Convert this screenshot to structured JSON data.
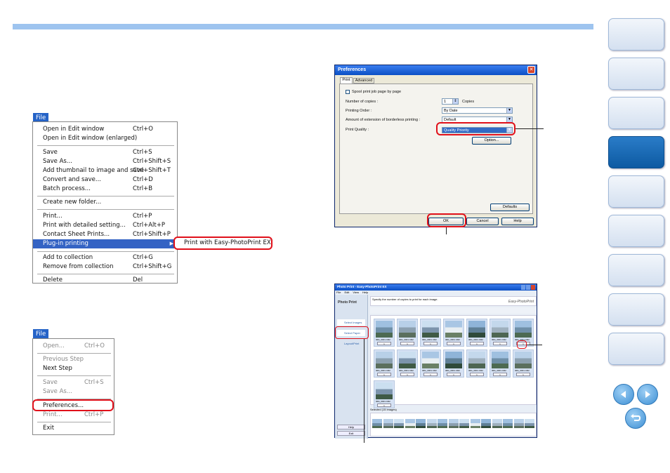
{
  "menu1": {
    "title": "File",
    "items": [
      {
        "label": "Open in Edit window",
        "shortcut": "Ctrl+O"
      },
      {
        "label": "Open in Edit window (enlarged)",
        "shortcut": ""
      },
      {
        "label": "Save",
        "shortcut": "Ctrl+S"
      },
      {
        "label": "Save As...",
        "shortcut": "Ctrl+Shift+S"
      },
      {
        "label": "Add thumbnail to image and save",
        "shortcut": "Ctrl+Shift+T"
      },
      {
        "label": "Convert and save...",
        "shortcut": "Ctrl+D"
      },
      {
        "label": "Batch process...",
        "shortcut": "Ctrl+B"
      },
      {
        "label": "Create new folder...",
        "shortcut": ""
      },
      {
        "label": "Print...",
        "shortcut": "Ctrl+P"
      },
      {
        "label": "Print with detailed setting...",
        "shortcut": "Ctrl+Alt+P"
      },
      {
        "label": "Contact Sheet Prints...",
        "shortcut": "Ctrl+Shift+P"
      },
      {
        "label": "Plug-in printing",
        "shortcut": ""
      },
      {
        "label": "Add to collection",
        "shortcut": "Ctrl+G"
      },
      {
        "label": "Remove from collection",
        "shortcut": "Ctrl+Shift+G"
      },
      {
        "label": "Delete",
        "shortcut": "Del"
      }
    ],
    "submenu": "Print with Easy-PhotoPrint EX"
  },
  "menu2": {
    "title": "File",
    "items": [
      {
        "label": "Open...",
        "shortcut": "Ctrl+O"
      },
      {
        "label": "Previous Step",
        "shortcut": ""
      },
      {
        "label": "Next Step",
        "shortcut": ""
      },
      {
        "label": "Save",
        "shortcut": "Ctrl+S"
      },
      {
        "label": "Save As...",
        "shortcut": ""
      },
      {
        "label": "Preferences...",
        "shortcut": ""
      },
      {
        "label": "Print...",
        "shortcut": "Ctrl+P"
      },
      {
        "label": "Exit",
        "shortcut": ""
      }
    ]
  },
  "prefs": {
    "title": "Preferences",
    "tabs": [
      "Print",
      "Advanced"
    ],
    "spool": "Spool print job page by page",
    "copies_label": "Number of copies :",
    "copies_value": "1",
    "copies_unit": "Copies",
    "order_label": "Printing Order :",
    "order_value": "By Date",
    "border_label": "Amount of extension of borderless printing :",
    "border_value": "Default",
    "quality_label": "Print Quality :",
    "quality_value": "Quality Priority",
    "option_btn": "Option...",
    "defaults_btn": "Defaults",
    "ok_btn": "OK",
    "cancel_btn": "Cancel",
    "help_btn": "Help"
  },
  "epp": {
    "title": "Photo Print - Easy-PhotoPrint EX",
    "menus": [
      "File",
      "Edit",
      "View",
      "Help"
    ],
    "side_title": "Photo Print",
    "steps": [
      "Select Images",
      "Select Paper",
      "Layout/Print"
    ],
    "help_btn": "Help",
    "exit_btn": "Exit",
    "instruction": "Specify the number of copies to print for each image.",
    "brand": "Easy-PhotoPrint",
    "selected": "Selected (15 images)",
    "thumb_label": "IMG_0001.CR2",
    "thumb_count": "1"
  },
  "colors": {
    "accent": "#9ec4ef",
    "highlight": "#e0101a",
    "nav_active": "#1a6ab5"
  }
}
